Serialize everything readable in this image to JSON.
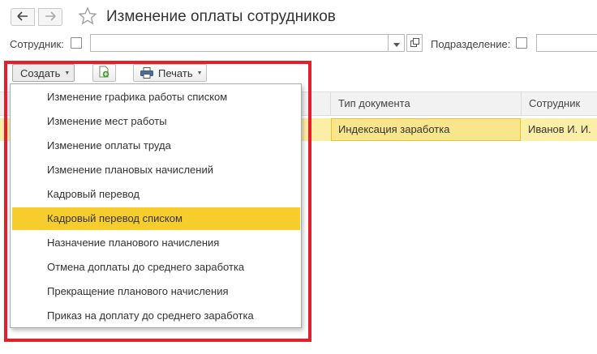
{
  "window": {
    "title": "Изменение оплаты сотрудников"
  },
  "filters": {
    "employee_label": "Сотрудник:",
    "employee_value": "",
    "department_label": "Подразделение:",
    "department_value": ""
  },
  "toolbar": {
    "create_label": "Создать",
    "print_label": "Печать"
  },
  "table": {
    "columns": [
      "Тип документа",
      "Сотрудник"
    ],
    "rows": [
      {
        "doc_type": "Индексация заработка",
        "employee": "Иванов И. И."
      }
    ]
  },
  "create_menu": {
    "items": [
      "Изменение графика работы списком",
      "Изменение мест работы",
      "Изменение оплаты труда",
      "Изменение плановых начислений",
      "Кадровый перевод",
      "Кадровый перевод списком",
      "Назначение планового начисления",
      "Отмена доплаты до среднего заработка",
      "Прекращение планового начисления",
      "Приказ на доплату до среднего заработка"
    ],
    "highlighted_item": "Кадровый перевод списком"
  },
  "colors": {
    "highlight": "#f6cd2c",
    "selected_row": "#fbeea7",
    "annotation_frame": "#e2202a"
  },
  "icons": [
    "back-arrow-icon",
    "forward-arrow-icon",
    "star-icon",
    "dropdown-arrow-icon",
    "open-form-icon",
    "copy-document-icon",
    "printer-icon"
  ]
}
